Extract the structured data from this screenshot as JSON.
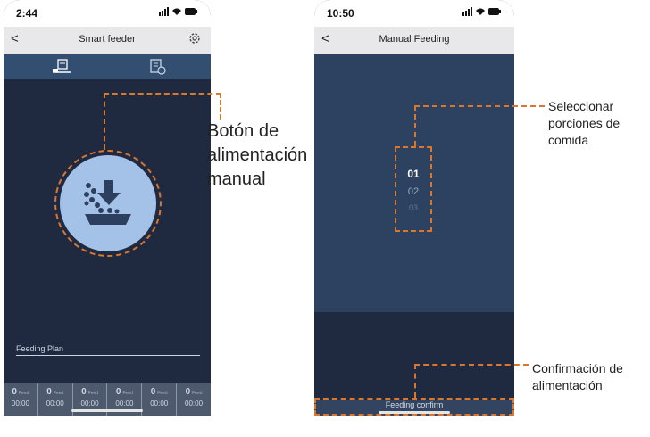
{
  "screen1": {
    "status": {
      "time": "2:44",
      "icons": "signal wifi battery"
    },
    "header": {
      "back": "<",
      "title": "Smart feeder",
      "settings_icon": "gear-icon"
    },
    "tabs": [
      {
        "icon": "feeder-device-icon"
      },
      {
        "icon": "feeding-log-icon"
      }
    ],
    "feed_button": {
      "icon": "manual-feed-icon"
    },
    "feeding_plan_label": "Feeding Plan",
    "slots": [
      {
        "count": "0",
        "unit": "Feed",
        "time": "00:00"
      },
      {
        "count": "0",
        "unit": "Feed",
        "time": "00:00"
      },
      {
        "count": "0",
        "unit": "Feed",
        "time": "00:00"
      },
      {
        "count": "0",
        "unit": "Feed",
        "time": "00:00"
      },
      {
        "count": "0",
        "unit": "Feed",
        "time": "00:00"
      },
      {
        "count": "0",
        "unit": "Feed",
        "time": "00:00"
      }
    ]
  },
  "screen2": {
    "status": {
      "time": "10:50",
      "icons": "signal wifi battery"
    },
    "header": {
      "back": "<",
      "title": "Manual Feeding"
    },
    "picker": {
      "options": [
        "01",
        "02",
        "03"
      ],
      "selected": "01"
    },
    "confirm_label": "Feeding confirm"
  },
  "annotations": {
    "manual_button": "Botón de alimentación manual",
    "portions": "Seleccionar porciones de comida",
    "confirm": "Confirmación de alimentación"
  },
  "colors": {
    "accent": "#d9772e",
    "background": "#1f2a40",
    "tab_bar": "#324e70",
    "button": "#a4c1e8"
  }
}
